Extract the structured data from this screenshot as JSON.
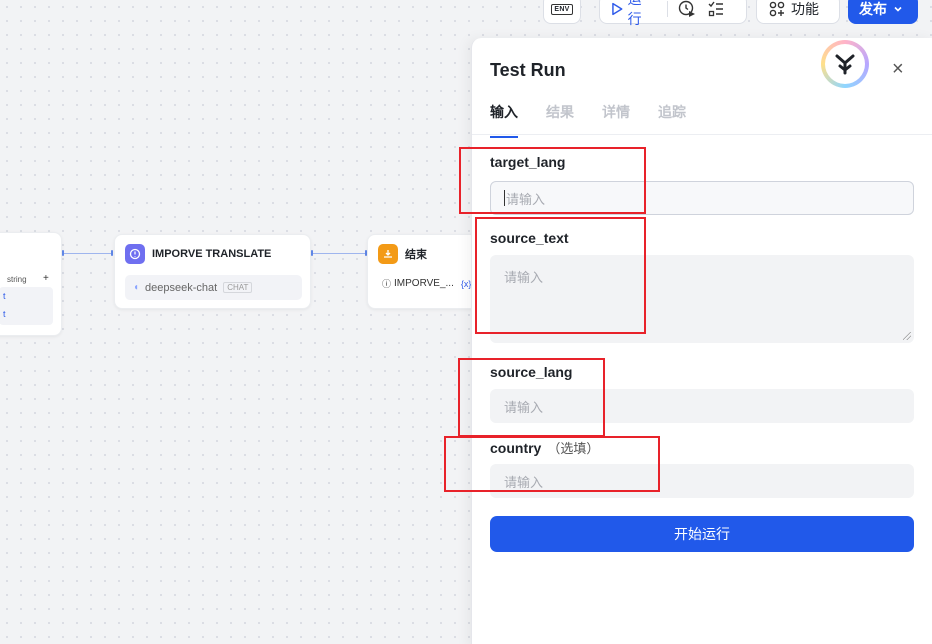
{
  "toolbar": {
    "env_label": "ENV",
    "run_label": "运行",
    "functions_label": "功能",
    "publish_label": "发布"
  },
  "canvas": {
    "left_node": {
      "type_label": "string",
      "add_symbol": "+",
      "var_1": "t",
      "var_2": "t"
    },
    "improve_node": {
      "title": "IMPORVE TRANSLATE",
      "model": "deepseek-chat",
      "model_tag": "CHAT"
    },
    "end_node": {
      "title": "结束",
      "output_ref": "IMPORVE_...",
      "var_tag": "{x}"
    }
  },
  "panel": {
    "title": "Test Run",
    "close_symbol": "×",
    "tabs": [
      {
        "label": "输入",
        "active": true
      },
      {
        "label": "结果",
        "active": false
      },
      {
        "label": "详情",
        "active": false
      },
      {
        "label": "追踪",
        "active": false
      }
    ],
    "fields": [
      {
        "name": "target_lang",
        "placeholder": "请输入",
        "optional": ""
      },
      {
        "name": "source_text",
        "placeholder": "请输入",
        "optional": ""
      },
      {
        "name": "source_lang",
        "placeholder": "请输入",
        "optional": ""
      },
      {
        "name": "country",
        "placeholder": "请输入",
        "optional": "（选填）"
      }
    ],
    "start_button": "开始运行"
  },
  "colors": {
    "primary": "#2159ea",
    "annotation": "#e8222a"
  }
}
